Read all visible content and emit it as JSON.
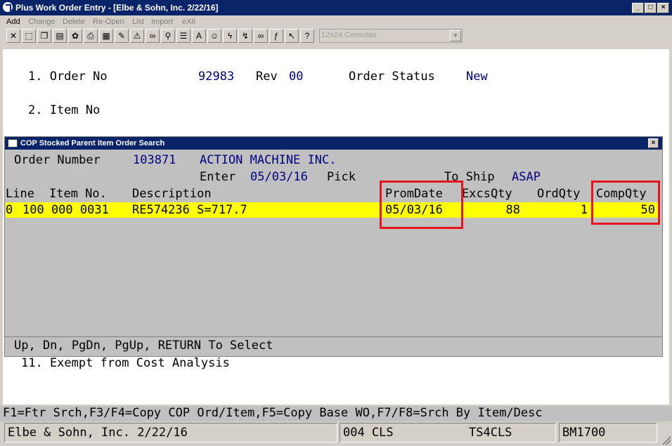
{
  "window": {
    "title": "Plus Work Order Entry - [Elbe & Sohn, Inc. 2/22/16]",
    "min_glyph": "_",
    "max_glyph": "□",
    "close_glyph": "×"
  },
  "menu": [
    {
      "label": "Add",
      "enabled": true
    },
    {
      "label": "Change",
      "enabled": false
    },
    {
      "label": "Delete",
      "enabled": false
    },
    {
      "label": "Re-Open",
      "enabled": false
    },
    {
      "label": "List",
      "enabled": false
    },
    {
      "label": "Import",
      "enabled": false
    },
    {
      "label": "eXit",
      "enabled": false
    }
  ],
  "toolbar": {
    "icons": [
      {
        "name": "close-x-icon",
        "glyph": "✕"
      },
      {
        "name": "select-icon",
        "glyph": "⬚"
      },
      {
        "name": "copy-icon",
        "glyph": "❐"
      },
      {
        "name": "paste-icon",
        "glyph": "▤"
      },
      {
        "name": "settings-icon",
        "glyph": "✿"
      },
      {
        "name": "print-icon",
        "glyph": "⎙"
      },
      {
        "name": "note-icon",
        "glyph": "▦"
      },
      {
        "name": "notepad-icon",
        "glyph": "✎"
      },
      {
        "name": "warning-icon",
        "glyph": "⚠"
      },
      {
        "name": "binoculars-icon",
        "glyph": "∞"
      },
      {
        "name": "search-icon",
        "glyph": "⚲"
      },
      {
        "name": "list-icon",
        "glyph": "☰"
      },
      {
        "name": "font-icon",
        "glyph": "A"
      },
      {
        "name": "user-icon",
        "glyph": "☺"
      },
      {
        "name": "lightning-icon",
        "glyph": "ϟ"
      },
      {
        "name": "flash-icon",
        "glyph": "↯"
      },
      {
        "name": "link-icon",
        "glyph": "∞"
      },
      {
        "name": "function-icon",
        "glyph": "ƒ"
      },
      {
        "name": "pointer-icon",
        "glyph": "↖"
      },
      {
        "name": "help-icon",
        "glyph": "?"
      }
    ],
    "font_select": "12x24 Consolas",
    "dropdown_glyph": "▼"
  },
  "form": {
    "field1_label": "1. Order No",
    "order_no": "92983",
    "rev_label": "Rev",
    "rev": "00",
    "status_label": "Order Status",
    "status": "New",
    "field2_label": "2. Item No",
    "field11_label": "11. Exempt from Cost Analysis"
  },
  "dialog": {
    "title": "COP Stocked Parent Item Order Search",
    "close_glyph": "×",
    "order_number_label": "Order Number",
    "order_number": "103871",
    "customer": "ACTION MACHINE INC.",
    "enter_label": "Enter",
    "enter_date": "05/03/16",
    "pick_label": "Pick",
    "to_ship_label": "To Ship",
    "to_ship": "ASAP",
    "columns": {
      "line": "Line",
      "item_no": "Item No.",
      "description": "Description",
      "prom_date": "PromDate",
      "excs_qty": "ExcsQty",
      "ord_qty": "OrdQty",
      "comp_qty": "CompQty"
    },
    "row": {
      "line": "0",
      "item_no": "100 000 0031",
      "description": "RE574236 S=717.7",
      "prom_date": "05/03/16",
      "excs_qty": "88",
      "ord_qty": "1",
      "comp_qty": "50"
    },
    "footer": "Up, Dn, PgDn, PgUp, RETURN To Select"
  },
  "function_keys": "F1=Ftr Srch,F3/F4=Copy COP Ord/Item,F5=Copy Base WO,F7/F8=Srch By Item/Desc",
  "status": {
    "company": "Elbe & Sohn, Inc. 2/22/16",
    "user": "004 CLS",
    "terminal": "TS4CLS",
    "program": "BM1700"
  },
  "colors": {
    "title_bg": "#0a246a",
    "highlight_row": "#ffff00",
    "annotation_box": "#e8141c",
    "field_value": "#000080"
  }
}
